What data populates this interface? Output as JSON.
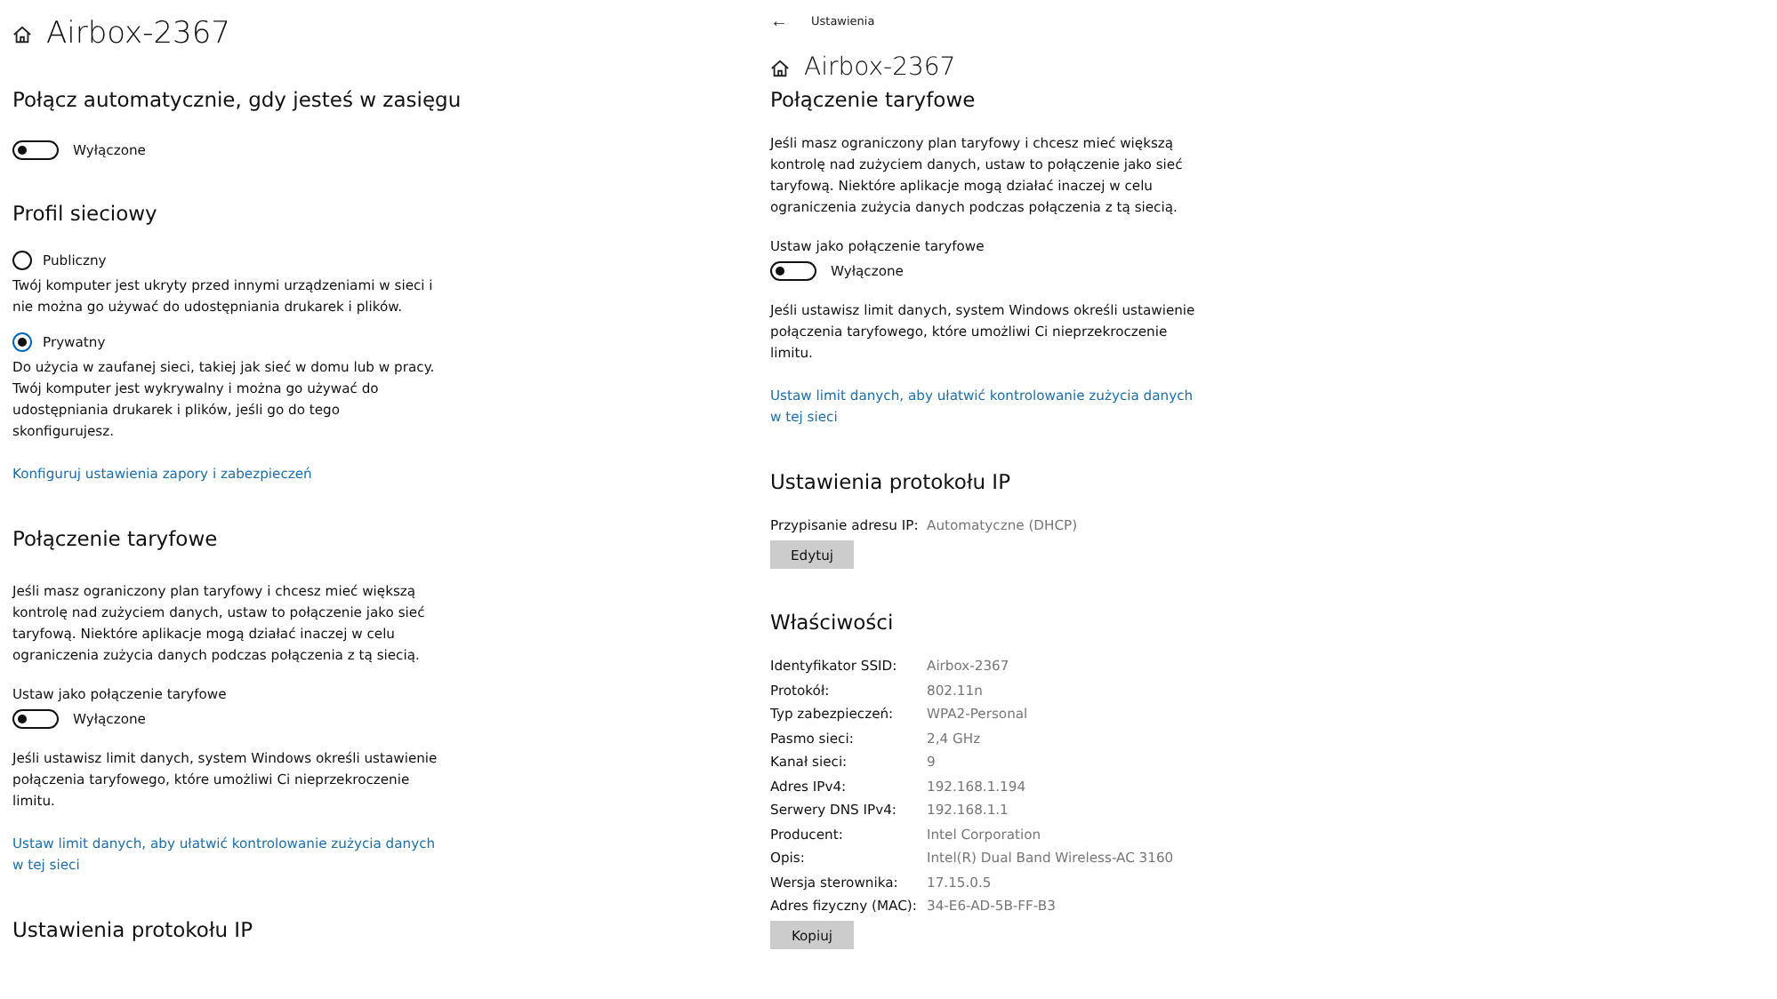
{
  "panes": [
    {
      "title": "Airbox-2367",
      "blocks": [
        {
          "kind": "heading",
          "text": "Połącz automatycznie, gdy jesteś w zasięgu"
        },
        {
          "kind": "toggle",
          "label": "Wyłączone",
          "on": false
        },
        {
          "kind": "heading",
          "text": "Profil sieciowy"
        },
        {
          "kind": "radio",
          "label": "Publiczny",
          "selected": false
        },
        {
          "kind": "text",
          "text": "Twój komputer jest ukryty przed innymi urządzeniami w sieci i nie można go używać do udostępniania drukarek i plików."
        },
        {
          "kind": "radio",
          "label": "Prywatny",
          "selected": true
        },
        {
          "kind": "text",
          "text": "Do użycia w zaufanej sieci, takiej jak sieć w domu lub w pracy. Twój komputer jest wykrywalny i można go używać do udostępniania drukarek i plików, jeśli go do tego skonfigurujesz."
        },
        {
          "kind": "link",
          "text": "Konfiguruj ustawienia zapory i zabezpieczeń"
        },
        {
          "kind": "heading",
          "text": "Połączenie taryfowe"
        },
        {
          "kind": "text",
          "text": "Jeśli masz ograniczony plan taryfowy i chcesz mieć większą kontrolę nad zużyciem danych, ustaw to połączenie jako sieć taryfową. Niektóre aplikacje mogą działać inaczej w celu ograniczenia zużycia danych podczas połączenia z tą siecią."
        },
        {
          "kind": "caption",
          "text": "Ustaw jako połączenie taryfowe"
        },
        {
          "kind": "toggle",
          "label": "Wyłączone",
          "on": false
        },
        {
          "kind": "text",
          "text": "Jeśli ustawisz limit danych, system Windows określi ustawienie połączenia taryfowego, które umożliwi Ci nieprzekroczenie limitu."
        },
        {
          "kind": "link",
          "text": "Ustaw limit danych, aby ułatwić kontrolowanie zużycia danych w tej sieci"
        },
        {
          "kind": "heading",
          "text": "Ustawienia protokołu IP"
        }
      ]
    },
    {
      "header": {
        "back": "←",
        "breadcrumb": "Ustawienia"
      },
      "title": "Airbox-2367",
      "blocks": [
        {
          "kind": "subheading",
          "text": "Połączenie taryfowe"
        },
        {
          "kind": "text",
          "text": "Jeśli masz ograniczony plan taryfowy i chcesz mieć większą kontrolę nad zużyciem danych, ustaw to połączenie jako sieć taryfową. Niektóre aplikacje mogą działać inaczej w celu ograniczenia zużycia danych podczas połączenia z tą siecią."
        },
        {
          "kind": "caption",
          "text": "Ustaw jako połączenie taryfowe"
        },
        {
          "kind": "toggle",
          "label": "Wyłączone",
          "on": false
        },
        {
          "kind": "text",
          "text": "Jeśli ustawisz limit danych, system Windows określi ustawienie połączenia taryfowego, które umożliwi Ci nieprzekroczenie limitu."
        },
        {
          "kind": "link",
          "text": "Ustaw limit danych, aby ułatwić kontrolowanie zużycia danych w tej sieci"
        },
        {
          "kind": "heading",
          "text": "Ustawienia protokołu IP"
        },
        {
          "kind": "properties",
          "rows": [
            {
              "label": "Przypisanie adresu IP:",
              "value": "Automatyczne (DHCP)"
            }
          ]
        },
        {
          "kind": "button",
          "text": "Edytuj"
        },
        {
          "kind": "heading",
          "text": "Właściwości"
        },
        {
          "kind": "properties",
          "rows": [
            {
              "label": "Identyfikator SSID:",
              "value": "Airbox-2367"
            },
            {
              "label": "Protokół:",
              "value": "802.11n"
            },
            {
              "label": "Typ zabezpieczeń:",
              "value": "WPA2-Personal"
            },
            {
              "label": "Pasmo sieci:",
              "value": "2,4 GHz"
            },
            {
              "label": "Kanał sieci:",
              "value": "9"
            },
            {
              "label": "Adres IPv4:",
              "value": "192.168.1.194"
            },
            {
              "label": "Serwery DNS IPv4:",
              "value": "192.168.1.1"
            },
            {
              "label": "Producent:",
              "value": "Intel Corporation"
            },
            {
              "label": "Opis:",
              "value": "Intel(R) Dual Band Wireless-AC 3160"
            },
            {
              "label": "Wersja sterownika:",
              "value": "17.15.0.5"
            },
            {
              "label": "Adres fizyczny (MAC):",
              "value": "34-E6-AD-5B-FF-B3"
            }
          ]
        },
        {
          "kind": "button",
          "text": "Kopiuj"
        }
      ]
    }
  ]
}
